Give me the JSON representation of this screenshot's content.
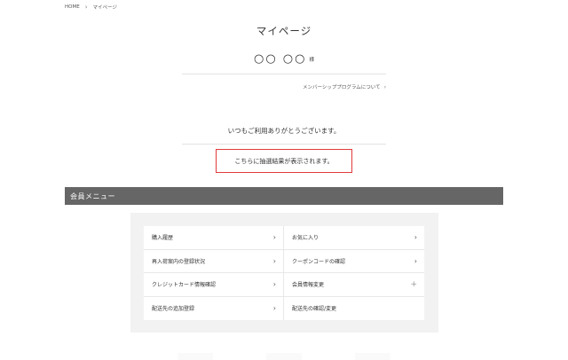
{
  "breadcrumb": {
    "home": "HOME",
    "current": "マイページ"
  },
  "page": {
    "title": "マイページ",
    "member_name": "○○ ○○",
    "honorific": "様",
    "program_link": "メンバーシッププログラムについて",
    "greeting": "いつもご利用ありがとうございます。",
    "lottery_message": "こちらに抽選結果が表示されます。"
  },
  "menu": {
    "header": "会員メニュー",
    "items": [
      {
        "label": "購入履歴",
        "icon": "chevron-right"
      },
      {
        "label": "お気に入り",
        "icon": "chevron-right"
      },
      {
        "label": "再入荷案内の登録状況",
        "icon": "chevron-right"
      },
      {
        "label": "クーポンコードの確認",
        "icon": "chevron-right"
      },
      {
        "label": "クレジットカード情報確認",
        "icon": "chevron-right"
      },
      {
        "label": "会員情報変更",
        "icon": "plus"
      },
      {
        "label": "配送先の追加登録",
        "icon": "chevron-right"
      },
      {
        "label": "配送先の確認/変更",
        "icon": ""
      }
    ]
  },
  "colors": {
    "menu_header_bg": "#666666",
    "highlight_border": "#e23a3a",
    "panel_bg": "#f2f2f2"
  }
}
